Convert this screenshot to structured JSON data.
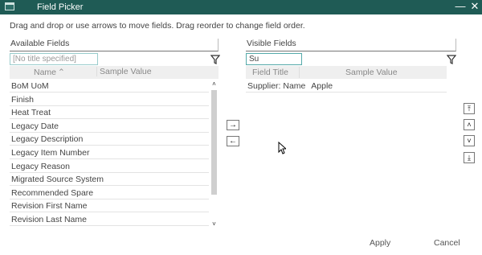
{
  "window": {
    "title": "Field Picker",
    "minimize_glyph": "—",
    "close_glyph": "✕",
    "app_icon": "window-icon"
  },
  "instructions": "Drag and drop or use arrows to move fields. Drag reorder to change field order.",
  "available": {
    "label": "Available Fields",
    "filter_placeholder": "[No title specified]",
    "filter_value": "",
    "col_name": "Name",
    "col_name_sort": "⌃",
    "col_sample": "Sample Value",
    "items": [
      "BoM UoM",
      "Finish",
      "Heat Treat",
      "Legacy Date",
      "Legacy Description",
      "Legacy Item Number",
      "Legacy Reason",
      "Migrated Source System",
      "Recommended Spare",
      "Revision First Name",
      "Revision Last Name"
    ],
    "scroll_up": "˄",
    "scroll_down": "˅"
  },
  "visible": {
    "label": "Visible Fields",
    "filter_value": "Su",
    "col_title": "Field Title",
    "col_sample": "Sample Value",
    "rows": [
      {
        "title": "Supplier: Name",
        "sample": "Apple"
      }
    ]
  },
  "move_buttons": {
    "add": "→",
    "remove": "←"
  },
  "order_buttons": {
    "top": "⤒",
    "up": "˄",
    "down": "˅",
    "bottom": "⤓"
  },
  "footer": {
    "apply": "Apply",
    "cancel": "Cancel"
  },
  "colors": {
    "titlebar": "#1f5b55",
    "filter_border": "#99cccc"
  }
}
